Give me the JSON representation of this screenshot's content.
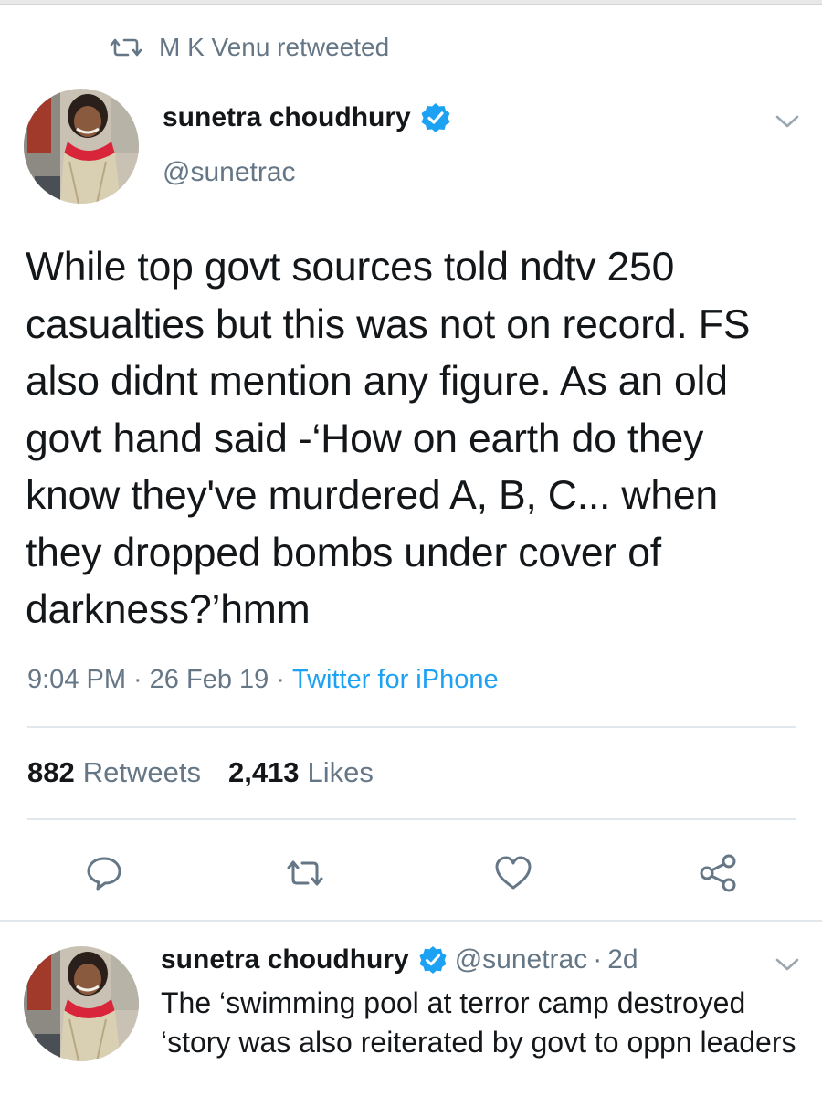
{
  "retweet_context": {
    "label": "M K Venu retweeted",
    "icon": "retweet-icon"
  },
  "tweet": {
    "author_name": "sunetra choudhury",
    "handle": "@sunetrac",
    "verified": true,
    "text": "While top govt sources told ndtv 250 casualties but this was not on record. FS also didnt mention any figure. As an old govt hand said -‘How on earth do they know they've murdered A, B, C... when they dropped bombs under cover of darkness?’hmm",
    "time": "9:04 PM",
    "date": "26 Feb 19",
    "separator": "·",
    "source": "Twitter for iPhone",
    "stats": {
      "retweets_count": "882",
      "retweets_label": "Retweets",
      "likes_count": "2,413",
      "likes_label": "Likes"
    },
    "actions": [
      "reply-icon",
      "retweet-icon",
      "like-icon",
      "share-icon"
    ]
  },
  "reply": {
    "author_name": "sunetra choudhury",
    "handle": "@sunetrac",
    "separator": "·",
    "time": "2d",
    "verified": true,
    "text": "The ‘swimming pool  at terror camp destroyed ‘story was also reiterated by govt to oppn leaders"
  },
  "colors": {
    "primary_text": "#14171a",
    "secondary_text": "#657786",
    "link": "#1da1f2",
    "verified": "#1da1f2",
    "divider": "#e1e8ed"
  }
}
